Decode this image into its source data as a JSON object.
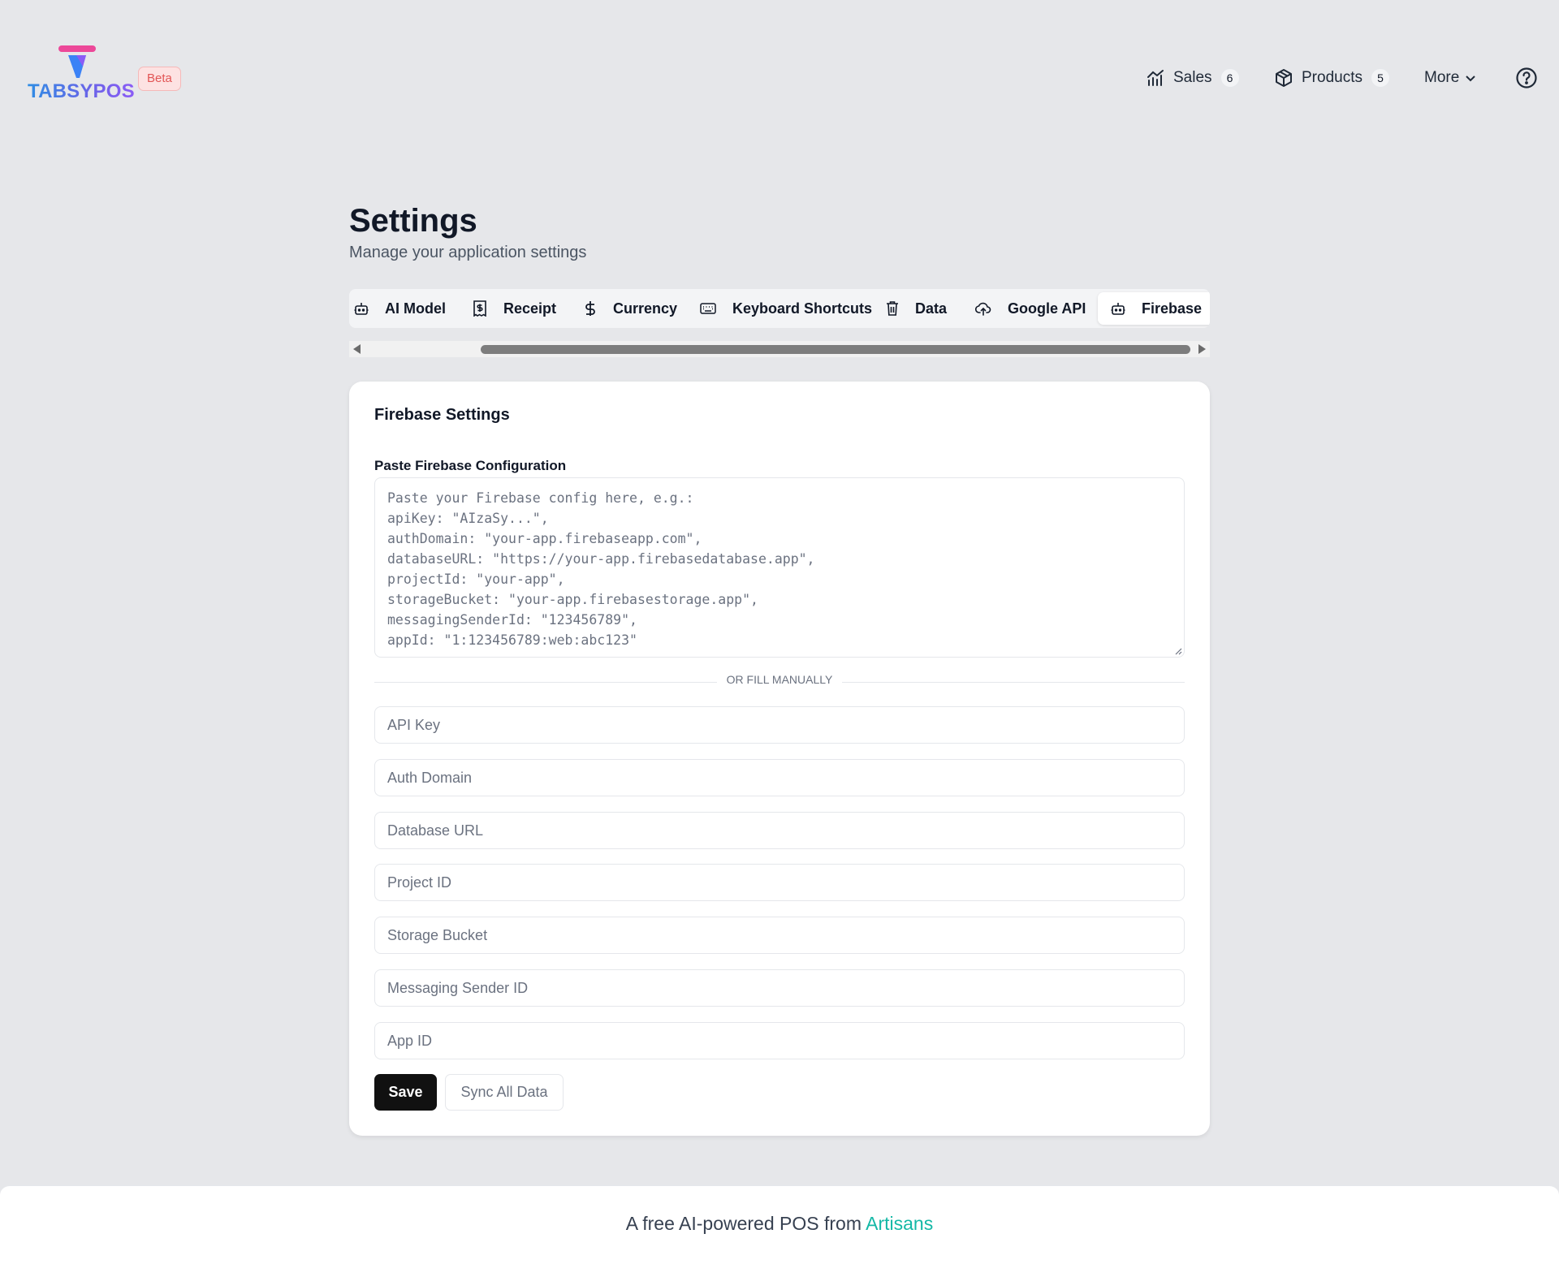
{
  "brand": {
    "name": "TABSYPOS",
    "badge": "Beta"
  },
  "nav": {
    "sales": {
      "label": "Sales",
      "count": "6"
    },
    "products": {
      "label": "Products",
      "count": "5"
    },
    "more": {
      "label": "More"
    }
  },
  "page": {
    "title": "Settings",
    "subtitle": "Manage your application settings"
  },
  "tabs": [
    {
      "label": "AI Model",
      "icon": "bot-icon"
    },
    {
      "label": "Receipt",
      "icon": "receipt-icon"
    },
    {
      "label": "Currency",
      "icon": "dollar-icon"
    },
    {
      "label": "Keyboard Shortcuts",
      "icon": "keyboard-icon"
    },
    {
      "label": "Data",
      "icon": "trash-icon"
    },
    {
      "label": "Google API",
      "icon": "cloud-upload-icon"
    },
    {
      "label": "Firebase",
      "icon": "bot-icon",
      "active": true
    }
  ],
  "firebase": {
    "title": "Firebase Settings",
    "config_label": "Paste Firebase Configuration",
    "config_placeholder": "Paste your Firebase config here, e.g.:\napiKey: \"AIzaSy...\",\nauthDomain: \"your-app.firebaseapp.com\",\ndatabaseURL: \"https://your-app.firebasedatabase.app\",\nprojectId: \"your-app\",\nstorageBucket: \"your-app.firebasestorage.app\",\nmessagingSenderId: \"123456789\",\nappId: \"1:123456789:web:abc123\"",
    "divider": "OR FILL MANUALLY",
    "fields": {
      "api_key": "API Key",
      "auth_domain": "Auth Domain",
      "database_url": "Database URL",
      "project_id": "Project ID",
      "storage_bucket": "Storage Bucket",
      "messaging_sender_id": "Messaging Sender ID",
      "app_id": "App ID"
    },
    "save_label": "Save",
    "sync_label": "Sync All Data"
  },
  "footer": {
    "text": "A free AI-powered POS from ",
    "link": "Artisans"
  },
  "colors": {
    "accent": "#14b8a6",
    "primary_button": "#111111",
    "beta": "#e25555"
  }
}
